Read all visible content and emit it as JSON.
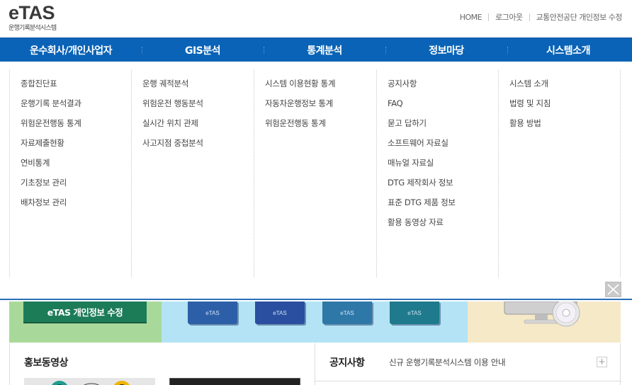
{
  "header": {
    "logo_main": "eTAS",
    "logo_sub": "운행기록분석시스템",
    "util_links": [
      "HOME",
      "로그아웃",
      "교통안전공단 개인정보 수정"
    ]
  },
  "gnb": {
    "items": [
      "운수회사/개인사업자",
      "GIS분석",
      "통계분석",
      "정보마당",
      "시스템소개"
    ]
  },
  "menu": {
    "col1": [
      "종합진단표",
      "운행기록 분석결과",
      "위험운전행동 통계",
      "자료제출현황",
      "연비통계",
      "기초정보 관리",
      "배차정보 관리"
    ],
    "col2": [
      "운행 궤적분석",
      "위험운전 행동분석",
      "실시간 위치 관제",
      "사고지점 중첩분석"
    ],
    "col3": [
      "시스템 이용현황 통계",
      "자동차운행정보 통계",
      "위험운전행동 통계"
    ],
    "col4": [
      "공지사항",
      "FAQ",
      "묻고 답하기",
      "소프트웨어 자료실",
      "매뉴얼 자료실",
      "DTG 제작회사 정보",
      "표준 DTG 제품 정보",
      "활용 동영상 자료"
    ],
    "col5": [
      "시스템 소개",
      "법령 및 지침",
      "활용 방법"
    ]
  },
  "banner": {
    "edit_button": "eTAS 개인정보 수정",
    "book_labels": [
      "eTAS",
      "eTAS",
      "eTAS",
      "eTAS"
    ]
  },
  "video": {
    "title": "홍보동영상"
  },
  "notice": {
    "title": "공지사항",
    "latest": "신규 운행기록분석시스템 이용 안내",
    "more": "+"
  },
  "colors": {
    "gnb_bg": "#0a63b6",
    "edit_btn": "#1d7c58",
    "banner_green": "#a9d99a",
    "banner_blue": "#b3e3f4",
    "banner_beige": "#f5e9c8"
  }
}
